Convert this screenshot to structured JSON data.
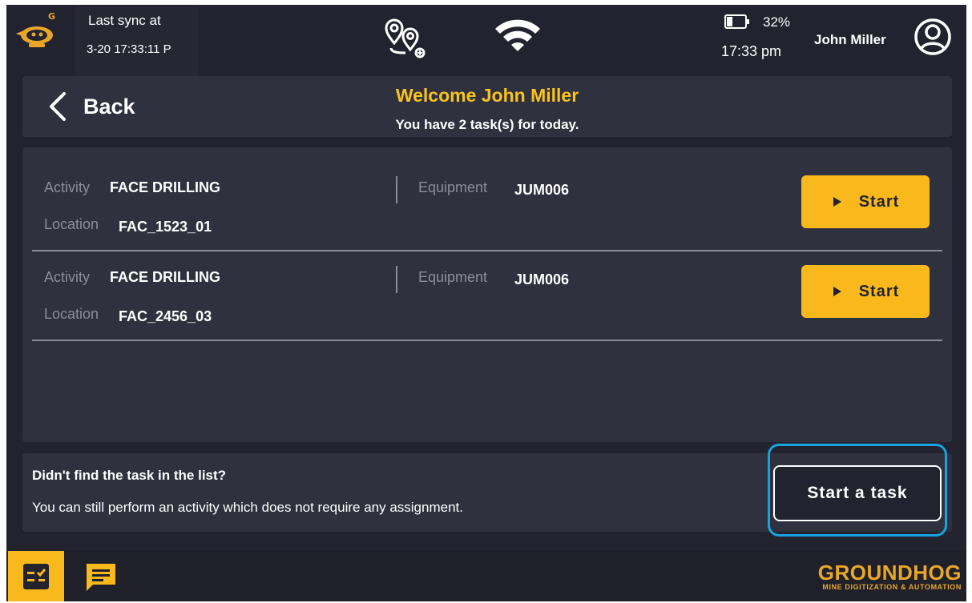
{
  "status_bar": {
    "sync_label": "Last sync at",
    "sync_time": "3-20 17:33:11 P",
    "battery_pct": "32%",
    "battery_level": 0.32,
    "clock": "17:33 pm",
    "user_name": "John Miller"
  },
  "header": {
    "back_label": "Back",
    "welcome": "Welcome John Miller",
    "tasks_count": "You have 2 task(s) for today."
  },
  "labels": {
    "activity": "Activity",
    "equipment": "Equipment",
    "location": "Location"
  },
  "tasks": [
    {
      "activity": "FACE DRILLING",
      "equipment": "JUM006",
      "location": "FAC_1523_01",
      "start_label": "Start"
    },
    {
      "activity": "FACE DRILLING",
      "equipment": "JUM006",
      "location": "FAC_2456_03",
      "start_label": "Start"
    }
  ],
  "prompt": {
    "title": "Didn't find the task in the list?",
    "text": "You can still perform an activity which does not require any assignment.",
    "button_label": "Start a task"
  },
  "brand": {
    "name": "GROUNDHOG",
    "tagline": "MINE DIGITIZATION & AUTOMATION"
  },
  "colors": {
    "background": "#22232e",
    "panel": "#30313f",
    "accent": "#f9b81b",
    "welcome": "#f9c21c",
    "highlight": "#16a4e0"
  }
}
